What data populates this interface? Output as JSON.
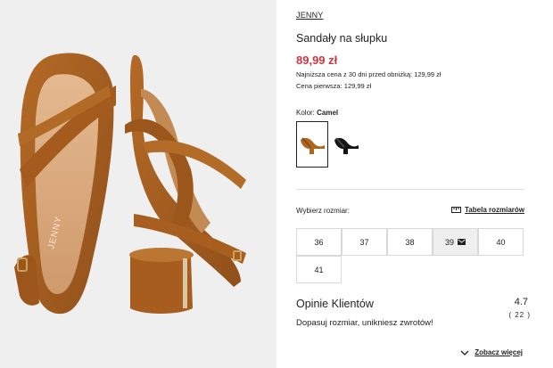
{
  "product": {
    "brand": "JENNY",
    "title": "Sandały na słupku",
    "price": "89,99 zł",
    "lowest_price_note": "Najniższa cena z 30 dni przed obniżką: 129,99 zł",
    "original_price_note": "Cena pierwsza: 129,99 zł",
    "image_brand_print": "JENNY"
  },
  "color": {
    "label": "Kolor:",
    "selected": "Camel",
    "swatches": [
      {
        "name": "Camel",
        "hex": "#b0651f",
        "selected": true
      },
      {
        "name": "Black",
        "hex": "#151515",
        "selected": false
      }
    ]
  },
  "sizes": {
    "label": "Wybierz rozmiar:",
    "chart_link": "Tabela rozmiarów",
    "options": [
      "36",
      "37",
      "38",
      "39",
      "40",
      "41"
    ],
    "notify_size": "39"
  },
  "reviews": {
    "title": "Opinie Klientów",
    "rating": "4.7",
    "count": "( 22 )",
    "fit_message": "Dopasuj rozmiar, unikniesz zwrotów!",
    "see_more": "Zobacz więcej"
  },
  "colors": {
    "price": "#d0353f",
    "suede": "#a85c1c",
    "background": "#efefef"
  }
}
